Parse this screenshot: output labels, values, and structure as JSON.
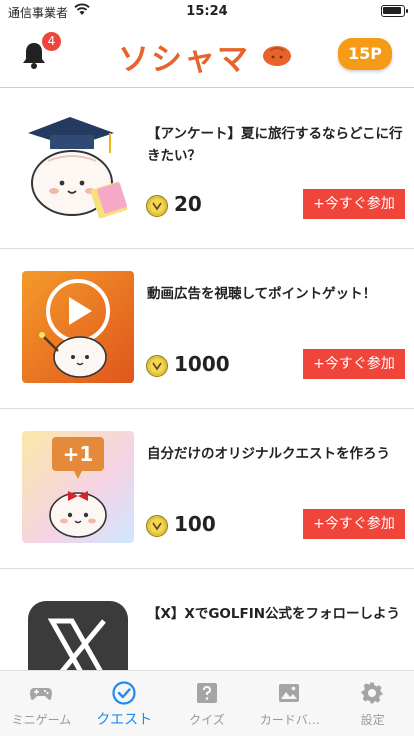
{
  "status_bar": {
    "carrier": "通信事業者",
    "time": "15:24"
  },
  "header": {
    "notification_count": "4",
    "logo_text": "ソシャマ",
    "points": "15P"
  },
  "quests": [
    {
      "title": "【アンケート】夏に旅行するならどこに行きたい？",
      "reward": "20",
      "join_label": "+今すぐ参加",
      "thumb_icon": "graduation-mascot"
    },
    {
      "title": "動画広告を視聴してポイントゲット！",
      "reward": "1000",
      "join_label": "+今すぐ参加",
      "thumb_icon": "play-video-mascot"
    },
    {
      "title": "自分だけのオリジナルクエストを作ろう",
      "reward": "100",
      "join_label": "+今すぐ参加",
      "thumb_icon": "plus-one-mascot",
      "thumb_badge": "+1"
    },
    {
      "title": "【X】XでGOLFIN公式をフォローしよう",
      "thumb_icon": "x-logo"
    }
  ],
  "tabs": [
    {
      "label": "ミニゲーム",
      "icon": "gamepad-icon",
      "active": false
    },
    {
      "label": "クエスト",
      "icon": "check-circle-icon",
      "active": true
    },
    {
      "label": "クイズ",
      "icon": "quiz-icon",
      "active": false
    },
    {
      "label": "カードバ…",
      "icon": "picture-icon",
      "active": false
    },
    {
      "label": "設定",
      "icon": "gear-icon",
      "active": false
    }
  ],
  "colors": {
    "accent_orange": "#e8632b",
    "points_badge": "#f59b16",
    "join_red": "#f0453a",
    "tab_active": "#1f8bf0",
    "tab_inactive": "#999999"
  }
}
